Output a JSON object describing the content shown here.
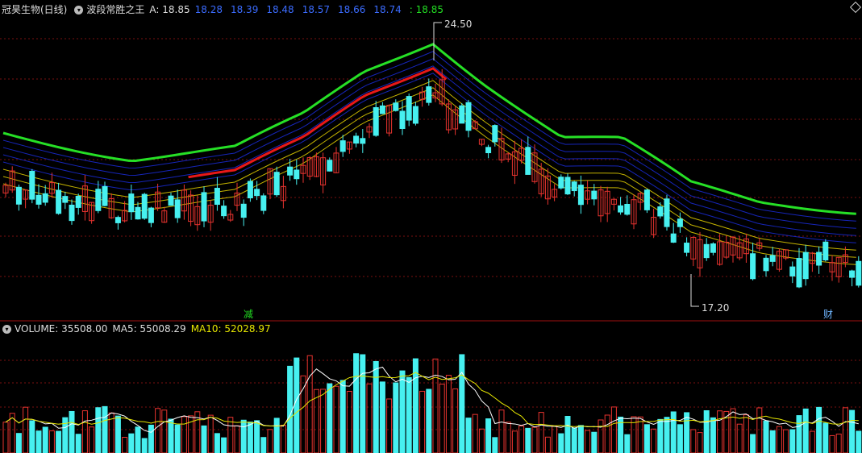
{
  "colors": {
    "up": "#e8332f",
    "down": "#47f0f0",
    "grid": "#7a1010",
    "ribbon_top": "#26e026",
    "ribbon_bottom": "#e81818",
    "fan_blue": "#1a2bd8",
    "fan_yellow": "#e6d200",
    "ma5": "#ffffff",
    "ma10": "#e6e600"
  },
  "header": {
    "stock_name": "冠昊生物(日线)",
    "indicator_menu_icon": "dropdown-circle-icon",
    "indicator_name": "波段常胜之王",
    "a_value": "A: 18.85",
    "values": [
      "18.28",
      "18.39",
      "18.48",
      "18.57",
      "18.66",
      "18.74"
    ],
    "last_value": ": 18.85"
  },
  "price_panel": {
    "high_label": "24.50",
    "low_label": "17.20",
    "marker_jian": "减",
    "marker_cai": "财"
  },
  "volume_panel": {
    "label": "VOLUME: 35508.00",
    "ma5": "MA5: 55008.29",
    "ma10": "MA10: 52028.97"
  }
}
